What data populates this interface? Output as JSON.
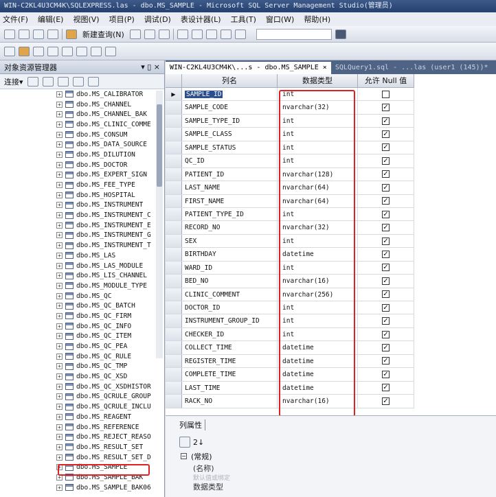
{
  "window": {
    "title": "WIN-C2KL4U3CM4K\\SQLEXPRESS.las - dbo.MS_SAMPLE - Microsoft SQL Server Management Studio(管理员)"
  },
  "menu": [
    "文件(F)",
    "编辑(E)",
    "视图(V)",
    "项目(P)",
    "调试(D)",
    "表设计器(L)",
    "工具(T)",
    "窗口(W)",
    "帮助(H)"
  ],
  "toolbar": {
    "new_query": "新建查询(N)"
  },
  "explorer": {
    "title": "对象资源管理器",
    "pin": "▾ ▯ ×",
    "connect_label": "连接▾",
    "tables": [
      "dbo.MS_CALIBRATOR",
      "dbo.MS_CHANNEL",
      "dbo.MS_CHANNEL_BAK",
      "dbo.MS_CLINIC_COMME",
      "dbo.MS_CONSUM",
      "dbo.MS_DATA_SOURCE",
      "dbo.MS_DILUTION",
      "dbo.MS_DOCTOR",
      "dbo.MS_EXPERT_SIGN",
      "dbo.MS_FEE_TYPE",
      "dbo.MS_HOSPITAL",
      "dbo.MS_INSTRUMENT",
      "dbo.MS_INSTRUMENT_C",
      "dbo.MS_INSTRUMENT_E",
      "dbo.MS_INSTRUMENT_G",
      "dbo.MS_INSTRUMENT_T",
      "dbo.MS_LAS",
      "dbo.MS_LAS_MODULE",
      "dbo.MS_LIS_CHANNEL",
      "dbo.MS_MODULE_TYPE",
      "dbo.MS_QC",
      "dbo.MS_QC_BATCH",
      "dbo.MS_QC_FIRM",
      "dbo.MS_QC_INFO",
      "dbo.MS_QC_ITEM",
      "dbo.MS_QC_PEA",
      "dbo.MS_QC_RULE",
      "dbo.MS_QC_TMP",
      "dbo.MS_QC_XSD",
      "dbo.MS_QC_XSDHISTOR",
      "dbo.MS_QCRULE_GROUP",
      "dbo.MS_QCRULE_INCLU",
      "dbo.MS_REAGENT",
      "dbo.MS_REFERENCE",
      "dbo.MS_REJECT_REASO",
      "dbo.MS_RESULT_SET",
      "dbo.MS_RESULT_SET_D",
      "dbo.MS_SAMPLE",
      "dbo.MS_SAMPLE_BAK",
      "dbo.MS_SAMPLE_BAK06"
    ]
  },
  "tabs": [
    {
      "label": "WIN-C2KL4U3CM4K\\...s - dbo.MS_SAMPLE",
      "close": "×"
    },
    {
      "label": "SQLQuery1.sql - ...las (user1 (145))*"
    }
  ],
  "designer": {
    "headers": {
      "name": "列名",
      "type": "数据类型",
      "null": "允许 Null 值"
    },
    "columns": [
      {
        "name": "SAMPLE_ID",
        "type": "int",
        "null": false
      },
      {
        "name": "SAMPLE_CODE",
        "type": "nvarchar(32)",
        "null": true
      },
      {
        "name": "SAMPLE_TYPE_ID",
        "type": "int",
        "null": true
      },
      {
        "name": "SAMPLE_CLASS",
        "type": "int",
        "null": true
      },
      {
        "name": "SAMPLE_STATUS",
        "type": "int",
        "null": true
      },
      {
        "name": "QC_ID",
        "type": "int",
        "null": true
      },
      {
        "name": "PATIENT_ID",
        "type": "nvarchar(128)",
        "null": true
      },
      {
        "name": "LAST_NAME",
        "type": "nvarchar(64)",
        "null": true
      },
      {
        "name": "FIRST_NAME",
        "type": "nvarchar(64)",
        "null": true
      },
      {
        "name": "PATIENT_TYPE_ID",
        "type": "int",
        "null": true
      },
      {
        "name": "RECORD_NO",
        "type": "nvarchar(32)",
        "null": true
      },
      {
        "name": "SEX",
        "type": "int",
        "null": true
      },
      {
        "name": "BIRTHDAY",
        "type": "datetime",
        "null": true
      },
      {
        "name": "WARD_ID",
        "type": "int",
        "null": true
      },
      {
        "name": "BED_NO",
        "type": "nvarchar(16)",
        "null": true
      },
      {
        "name": "CLINIC_COMMENT",
        "type": "nvarchar(256)",
        "null": true
      },
      {
        "name": "DOCTOR_ID",
        "type": "int",
        "null": true
      },
      {
        "name": "INSTRUMENT_GROUP_ID",
        "type": "int",
        "null": true
      },
      {
        "name": "CHECKER_ID",
        "type": "int",
        "null": true
      },
      {
        "name": "COLLECT_TIME",
        "type": "datetime",
        "null": true
      },
      {
        "name": "REGISTER_TIME",
        "type": "datetime",
        "null": true
      },
      {
        "name": "COMPLETE_TIME",
        "type": "datetime",
        "null": true
      },
      {
        "name": "LAST_TIME",
        "type": "datetime",
        "null": true
      },
      {
        "name": "RACK_NO",
        "type": "nvarchar(16)",
        "null": true
      }
    ],
    "key_marker": "▶"
  },
  "properties": {
    "tab_label": "列属性",
    "sort_label": "2↓",
    "section": "(常规)",
    "fields": [
      "(名称)",
      "数据类型"
    ],
    "dim_field": "默认值或绑定"
  },
  "colors": {
    "highlight": "#e02020",
    "title_bg": "#24406e"
  }
}
